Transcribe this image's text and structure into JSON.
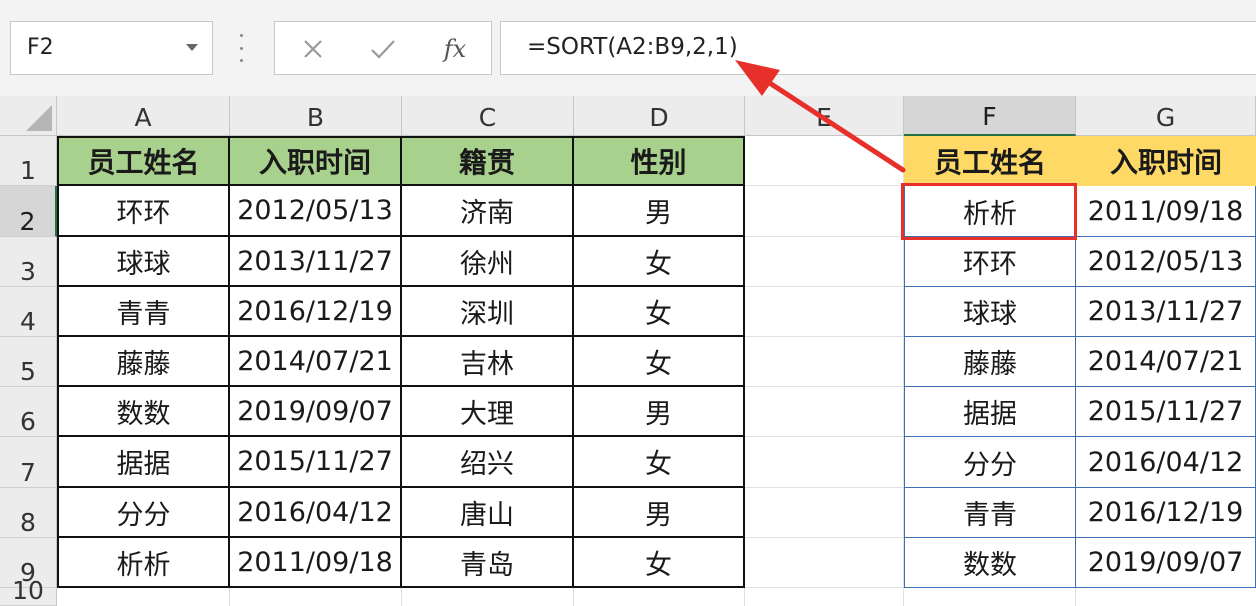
{
  "formula_bar": {
    "name_box": "F2",
    "cancel_icon": "close-icon",
    "enter_icon": "check-icon",
    "fx_label": "fx",
    "formula": "=SORT(A2:B9,2,1)"
  },
  "sheet": {
    "columns": [
      "A",
      "B",
      "C",
      "D",
      "E",
      "F",
      "G"
    ],
    "rows": [
      "1",
      "2",
      "3",
      "4",
      "5",
      "6",
      "7",
      "8",
      "9",
      "10"
    ],
    "selected_cell": "F2",
    "source_headers": [
      "员工姓名",
      "入职时间",
      "籍贯",
      "性别"
    ],
    "source_rows": [
      [
        "环环",
        "2012/05/13",
        "济南",
        "男"
      ],
      [
        "球球",
        "2013/11/27",
        "徐州",
        "女"
      ],
      [
        "青青",
        "2016/12/19",
        "深圳",
        "女"
      ],
      [
        "藤藤",
        "2014/07/21",
        "吉林",
        "女"
      ],
      [
        "数数",
        "2019/09/07",
        "大理",
        "男"
      ],
      [
        "据据",
        "2015/11/27",
        "绍兴",
        "女"
      ],
      [
        "分分",
        "2016/04/12",
        "唐山",
        "男"
      ],
      [
        "析析",
        "2011/09/18",
        "青岛",
        "女"
      ]
    ],
    "result_headers": [
      "员工姓名",
      "入职时间"
    ],
    "result_rows": [
      [
        "析析",
        "2011/09/18"
      ],
      [
        "环环",
        "2012/05/13"
      ],
      [
        "球球",
        "2013/11/27"
      ],
      [
        "藤藤",
        "2014/07/21"
      ],
      [
        "据据",
        "2015/11/27"
      ],
      [
        "分分",
        "2016/04/12"
      ],
      [
        "青青",
        "2016/12/19"
      ],
      [
        "数数",
        "2019/09/07"
      ]
    ]
  },
  "colors": {
    "source_header_fill": "#a9d18e",
    "result_header_fill": "#ffd966",
    "annotation_red": "#e8302a",
    "selection_green": "#217346"
  }
}
